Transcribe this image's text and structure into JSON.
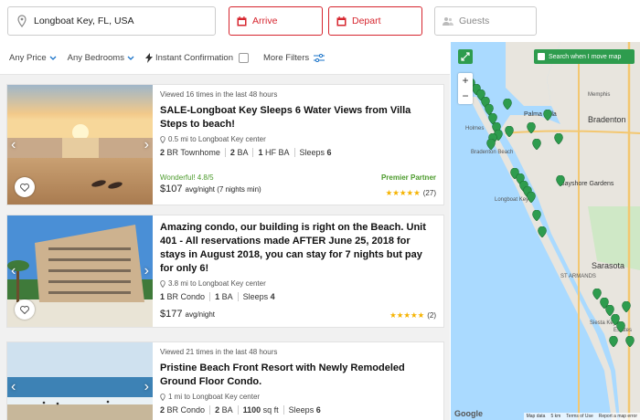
{
  "search": {
    "value": "Longboat Key, FL, USA",
    "arrive": "Arrive",
    "depart": "Depart",
    "guests": "Guests"
  },
  "filters": {
    "price": "Any Price",
    "bedrooms": "Any Bedrooms",
    "instant": "Instant Confirmation",
    "more": "More Filters"
  },
  "listings": [
    {
      "views": "Viewed 16 times in the last 48 hours",
      "title": "SALE-Longboat Key Sleeps 6 Water Views from Villa Steps to beach!",
      "distance": "0.5 mi to Longboat Key center",
      "specs": [
        [
          "2",
          "BR Townhome"
        ],
        [
          "2",
          "BA"
        ],
        [
          "1",
          "HF BA"
        ],
        [
          "Sleeps",
          "6"
        ]
      ],
      "rating_label": "Wonderful! 4.8/5",
      "price": "$107",
      "price_suffix": "avg/night (7 nights min)",
      "partner": "Premier Partner",
      "stars": "★★★★★",
      "review_count": "(27)"
    },
    {
      "views": "",
      "title": "Amazing condo, our building is right on the Beach. Unit 401 - All reservations made AFTER June 25, 2018 for stays in August 2018, you can stay for 7 nights but pay for only 6!",
      "distance": "3.8 mi to Longboat Key center",
      "specs": [
        [
          "1",
          "BR Condo"
        ],
        [
          "1",
          "BA"
        ],
        [
          "Sleeps",
          "4"
        ]
      ],
      "rating_label": "",
      "price": "$177",
      "price_suffix": "avg/night",
      "partner": "",
      "stars": "★★★★★",
      "review_count": "(2)"
    },
    {
      "views": "Viewed 21 times in the last 48 hours",
      "title": "Pristine Beach Front Resort with Newly Remodeled Ground Floor Condo.",
      "distance": "1 mi to Longboat Key center",
      "specs": [
        [
          "2",
          "BR Condo"
        ],
        [
          "2",
          "BA"
        ],
        [
          "1100",
          "sq ft"
        ],
        [
          "Sleeps",
          "6"
        ]
      ],
      "rating_label": "",
      "price": "",
      "price_suffix": "",
      "partner": "",
      "stars": "",
      "review_count": ""
    }
  ],
  "map": {
    "toggle": "Search when I move map",
    "zoom_in": "+",
    "zoom_out": "−",
    "labels": {
      "palma_sola": "Palma Sola",
      "bradenton": "Bradenton",
      "memphis": "Memphis",
      "holmes": "Holmes",
      "bayshore": "Bayshore Gardens",
      "sarasota": "Sarasota",
      "longboat": "Longboat Key",
      "st_armands": "ST ARMANDS",
      "bradenton_beach": "Bradenton Beach",
      "siesta": "Siesta Key",
      "estates": "Estates"
    },
    "attrib": [
      "Map data",
      "5 km",
      "Terms of Use",
      "Report a map error"
    ],
    "google": "Google"
  },
  "colors": {
    "accent_red": "#d6252e",
    "brand_green": "#2e9c4e",
    "rating_green": "#4b9a2b",
    "star": "#f5b300"
  }
}
